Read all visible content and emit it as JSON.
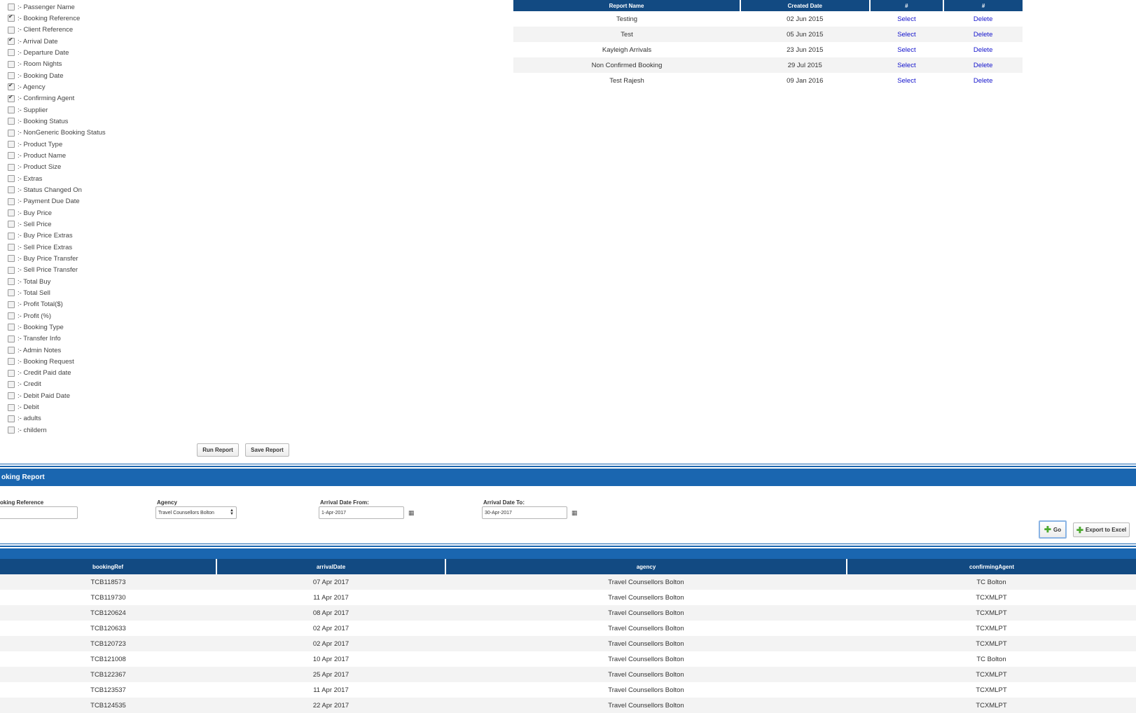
{
  "fields": [
    {
      "label": ":- Passenger Name",
      "checked": false
    },
    {
      "label": ":- Booking Reference",
      "checked": true
    },
    {
      "label": ":- Client Reference",
      "checked": false
    },
    {
      "label": ":- Arrival Date",
      "checked": true
    },
    {
      "label": ":- Departure Date",
      "checked": false
    },
    {
      "label": ":- Room Nights",
      "checked": false
    },
    {
      "label": ":- Booking Date",
      "checked": false
    },
    {
      "label": ":- Agency",
      "checked": true
    },
    {
      "label": ":- Confirming Agent",
      "checked": true
    },
    {
      "label": ":- Supplier",
      "checked": false
    },
    {
      "label": ":- Booking Status",
      "checked": false
    },
    {
      "label": ":- NonGeneric Booking Status",
      "checked": false
    },
    {
      "label": ":- Product Type",
      "checked": false
    },
    {
      "label": ":- Product Name",
      "checked": false
    },
    {
      "label": ":- Product Size",
      "checked": false
    },
    {
      "label": ":- Extras",
      "checked": false
    },
    {
      "label": ":- Status Changed On",
      "checked": false
    },
    {
      "label": ":- Payment Due Date",
      "checked": false
    },
    {
      "label": ":- Buy Price",
      "checked": false
    },
    {
      "label": ":- Sell Price",
      "checked": false
    },
    {
      "label": ":- Buy Price Extras",
      "checked": false
    },
    {
      "label": ":- Sell Price Extras",
      "checked": false
    },
    {
      "label": ":- Buy Price Transfer",
      "checked": false
    },
    {
      "label": ":- Sell Price Transfer",
      "checked": false
    },
    {
      "label": ":- Total Buy",
      "checked": false
    },
    {
      "label": ":- Total Sell",
      "checked": false
    },
    {
      "label": ":- Profit Total($)",
      "checked": false
    },
    {
      "label": ":- Profit (%)",
      "checked": false
    },
    {
      "label": ":- Booking Type",
      "checked": false
    },
    {
      "label": ":- Transfer Info",
      "checked": false
    },
    {
      "label": ":- Admin Notes",
      "checked": false
    },
    {
      "label": ":- Booking Request",
      "checked": false
    },
    {
      "label": ":- Credit Paid date",
      "checked": false
    },
    {
      "label": ":- Credit",
      "checked": false
    },
    {
      "label": ":- Debit Paid Date",
      "checked": false
    },
    {
      "label": ":- Debit",
      "checked": false
    },
    {
      "label": ":- adults",
      "checked": false
    },
    {
      "label": ":- childern",
      "checked": false
    }
  ],
  "actions": {
    "run_report": "Run Report",
    "save_report": "Save Report"
  },
  "saved_reports": {
    "headers": [
      "Report Name",
      "Created Date",
      "#",
      "#"
    ],
    "rows": [
      {
        "name": "Testing",
        "date": "02 Jun 2015",
        "select": "Select",
        "delete": "Delete"
      },
      {
        "name": "Test",
        "date": "05 Jun 2015",
        "select": "Select",
        "delete": "Delete"
      },
      {
        "name": "Kayleigh Arrivals",
        "date": "23 Jun 2015",
        "select": "Select",
        "delete": "Delete"
      },
      {
        "name": "Non Confirmed Booking",
        "date": "29 Jul 2015",
        "select": "Select",
        "delete": "Delete"
      },
      {
        "name": "Test Rajesh",
        "date": "09 Jan 2016",
        "select": "Select",
        "delete": "Delete"
      }
    ]
  },
  "booking_report": {
    "title": "oking Report",
    "filters": {
      "booking_reference_label": "oking Reference",
      "booking_reference_value": "",
      "agency_label": "Agency",
      "agency_value": "Travel Counsellors Bolton",
      "arrival_from_label": "Arrival Date From:",
      "arrival_from_value": "1-Apr-2017",
      "arrival_to_label": "Arrival Date To:",
      "arrival_to_value": "30-Apr-2017"
    },
    "go_label": "Go",
    "export_label": "Export to Excel",
    "headers": [
      "bookingRef",
      "arrivalDate",
      "agency",
      "confirmingAgent"
    ],
    "rows": [
      [
        "TCB118573",
        "07 Apr 2017",
        "Travel Counsellors Bolton",
        "TC Bolton"
      ],
      [
        "TCB119730",
        "11 Apr 2017",
        "Travel Counsellors Bolton",
        "TCXMLPT"
      ],
      [
        "TCB120624",
        "08 Apr 2017",
        "Travel Counsellors Bolton",
        "TCXMLPT"
      ],
      [
        "TCB120633",
        "02 Apr 2017",
        "Travel Counsellors Bolton",
        "TCXMLPT"
      ],
      [
        "TCB120723",
        "02 Apr 2017",
        "Travel Counsellors Bolton",
        "TCXMLPT"
      ],
      [
        "TCB121008",
        "10 Apr 2017",
        "Travel Counsellors Bolton",
        "TC Bolton"
      ],
      [
        "TCB122367",
        "25 Apr 2017",
        "Travel Counsellors Bolton",
        "TCXMLPT"
      ],
      [
        "TCB123537",
        "11 Apr 2017",
        "Travel Counsellors Bolton",
        "TCXMLPT"
      ],
      [
        "TCB124535",
        "22 Apr 2017",
        "Travel Counsellors Bolton",
        "TCXMLPT"
      ]
    ]
  },
  "colors": {
    "header_navy": "#124a82",
    "bar_blue": "#1a66b0",
    "link_blue": "#1111cc",
    "plus_green": "#4caa2f"
  }
}
